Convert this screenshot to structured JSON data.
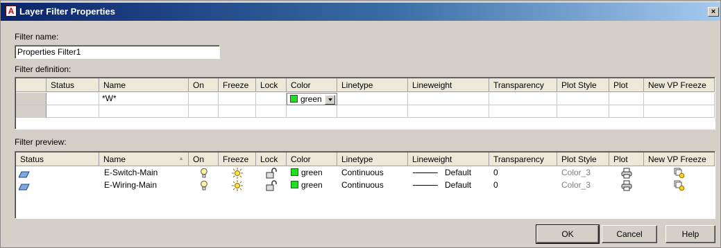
{
  "window": {
    "title": "Layer Filter Properties",
    "app_icon_letter": "A",
    "close_glyph": "×"
  },
  "filter_name": {
    "label": "Filter name:",
    "value": "Properties Filter1"
  },
  "definition": {
    "label": "Filter definition:",
    "columns": [
      "Status",
      "Name",
      "On",
      "Freeze",
      "Lock",
      "Color",
      "Linetype",
      "Lineweight",
      "Transparency",
      "Plot Style",
      "Plot",
      "New VP Freeze"
    ],
    "rows": [
      {
        "name": "*W*",
        "color": "green"
      }
    ]
  },
  "preview": {
    "label": "Filter preview:",
    "columns": [
      "Status",
      "Name",
      "On",
      "Freeze",
      "Lock",
      "Color",
      "Linetype",
      "Lineweight",
      "Transparency",
      "Plot Style",
      "Plot",
      "New VP Freeze"
    ],
    "sort_glyph": "▲",
    "rows": [
      {
        "name": "E-Switch-Main",
        "color": "green",
        "linetype": "Continuous",
        "lineweight": "Default",
        "transparency": "0",
        "plot_style": "Color_3"
      },
      {
        "name": "E-Wiring-Main",
        "color": "green",
        "linetype": "Continuous",
        "lineweight": "Default",
        "transparency": "0",
        "plot_style": "Color_3"
      }
    ]
  },
  "buttons": {
    "ok": "OK",
    "cancel": "Cancel",
    "help": "Help"
  },
  "colors": {
    "layer_color": "#22dd22",
    "titlebar_start": "#0a246a",
    "titlebar_end": "#a6caf0"
  }
}
